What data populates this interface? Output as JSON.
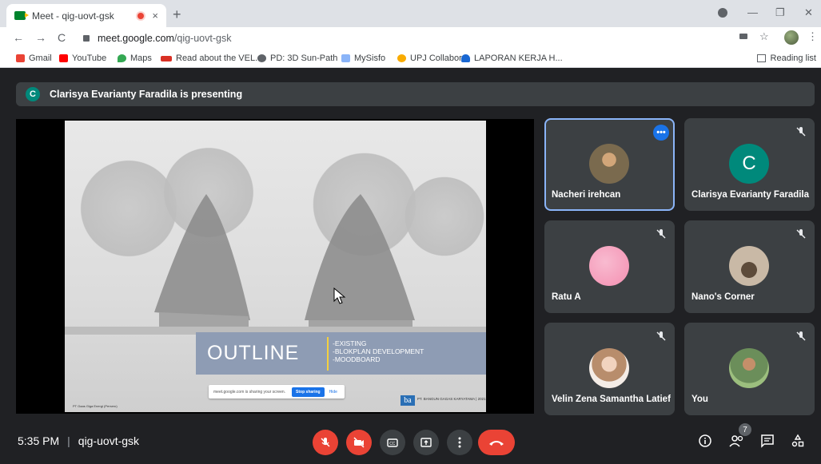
{
  "browser": {
    "tab_title": "Meet - qig-uovt-gsk",
    "tab_close": "×",
    "new_tab": "+",
    "url_host": "meet.google.com",
    "url_path": "/qig-uovt-gsk",
    "minimize": "—",
    "restore": "❐",
    "close": "✕",
    "menu": "⋮",
    "star": "☆"
  },
  "bookmarks": [
    {
      "label": "Gmail",
      "color": "#ea4335"
    },
    {
      "label": "YouTube",
      "color": "#ff0000"
    },
    {
      "label": "Maps",
      "color": "#34a853"
    },
    {
      "label": "Read about the VEL...",
      "color": "#d93025"
    },
    {
      "label": "PD: 3D Sun-Path",
      "color": "#5f6368"
    },
    {
      "label": "MySisfo",
      "color": "#8ab4f8"
    },
    {
      "label": "UPJ Collabor",
      "color": "#f9ab00"
    },
    {
      "label": "LAPORAN KERJA H...",
      "color": "#1967d2"
    }
  ],
  "reading_list": "Reading list",
  "presenting": {
    "initial": "C",
    "text": "Clarisya Evarianty Faradila is presenting"
  },
  "slide": {
    "title": "OUTLINE",
    "items": [
      "-EXISTING",
      "-BLOKPLAN DEVELOPMENT",
      "-MOODBOARD"
    ],
    "share_text": "meet.google.com is sharing your screen.",
    "stop_sharing": "Stop sharing",
    "hide": "Hide",
    "logo": "ba",
    "company": "PT. BANGUN GAGAS KARYATAMA | 2021",
    "credit": "PT Gaas Giga Energi (Persero)"
  },
  "participants": [
    {
      "name": "Nacheri irehcan",
      "initial": "",
      "avatar_color": "#7a6a4e",
      "active": true,
      "muted": false
    },
    {
      "name": "Clarisya Evarianty Faradila",
      "initial": "C",
      "avatar_color": "#00897b",
      "active": false,
      "muted": true
    },
    {
      "name": "Ratu A",
      "initial": "",
      "avatar_color": "#f48fb1",
      "active": false,
      "muted": true
    },
    {
      "name": "Nano's Corner",
      "initial": "",
      "avatar_color": "#8d7b68",
      "active": false,
      "muted": true
    },
    {
      "name": "Velin Zena Samantha Latief",
      "initial": "",
      "avatar_color": "#d8b8a0",
      "active": false,
      "muted": true
    },
    {
      "name": "You",
      "initial": "",
      "avatar_color": "#6b8e5a",
      "active": false,
      "muted": true
    }
  ],
  "more_options": "•••",
  "meeting": {
    "time": "5:35 PM",
    "separator": "|",
    "code": "qig-uovt-gsk"
  },
  "participant_count": "7"
}
